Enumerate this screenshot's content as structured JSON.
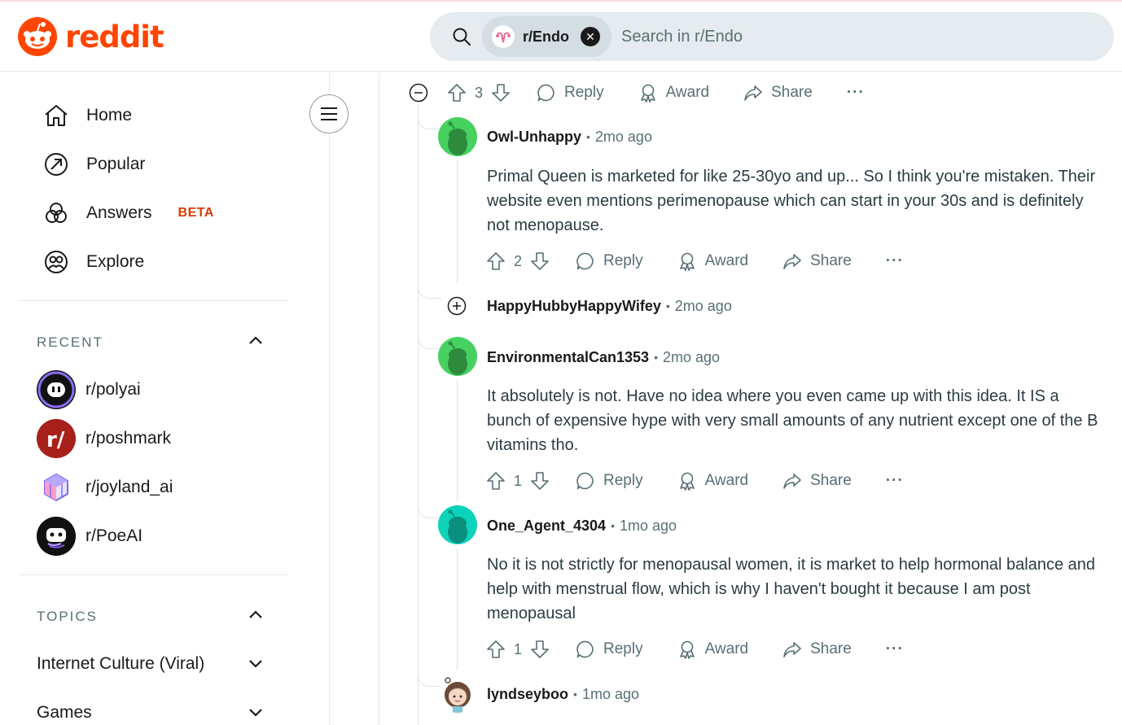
{
  "header": {
    "logo_text": "reddit",
    "search": {
      "chip_label": "r/Endo",
      "placeholder": "Search in r/Endo"
    }
  },
  "sidebar": {
    "nav": [
      {
        "label": "Home",
        "icon": "home-icon"
      },
      {
        "label": "Popular",
        "icon": "popular-icon"
      },
      {
        "label": "Answers",
        "icon": "answers-icon",
        "badge": "BETA"
      },
      {
        "label": "Explore",
        "icon": "explore-icon"
      }
    ],
    "recent": {
      "heading": "RECENT",
      "items": [
        {
          "label": "r/polyai"
        },
        {
          "label": "r/poshmark"
        },
        {
          "label": "r/joyland_ai"
        },
        {
          "label": "r/PoeAI"
        }
      ]
    },
    "topics": {
      "heading": "TOPICS",
      "items": [
        {
          "label": "Internet Culture (Viral)"
        },
        {
          "label": "Games"
        }
      ]
    }
  },
  "actions": {
    "reply": "Reply",
    "award": "Award",
    "share": "Share",
    "more": "···"
  },
  "parent_actions": {
    "score": "3"
  },
  "comments": [
    {
      "author": "Owl-Unhappy",
      "time": "2mo ago",
      "body": "Primal Queen is marketed for like 25-30yo and up... So I think you're mistaken. Their website even mentions perimenopause which can start in your 30s and is definitely not menopause.",
      "score": "2",
      "avatar_color": "#46d160"
    },
    {
      "author": "HappyHubbyHappyWifey",
      "time": "2mo ago",
      "collapsed": true
    },
    {
      "author": "EnvironmentalCan1353",
      "time": "2mo ago",
      "body": "It absolutely is not. Have no idea where you even came up with this idea. It IS a bunch of expensive hype with very small amounts of any nutrient except one of the B vitamins tho.",
      "score": "1",
      "avatar_color": "#46d160"
    },
    {
      "author": "One_Agent_4304",
      "time": "1mo ago",
      "body": "No it is not strictly for menopausal women, it is market to help hormonal balance and help with menstrual flow, which is why I haven't bought it because I am post menopausal",
      "score": "1",
      "avatar_color": "#0dd3bb"
    },
    {
      "author": "lyndseyboo",
      "time": "1mo ago"
    }
  ],
  "colors": {
    "brand": "#ff4500",
    "beta": "#d93a00",
    "muted": "#576f76"
  }
}
